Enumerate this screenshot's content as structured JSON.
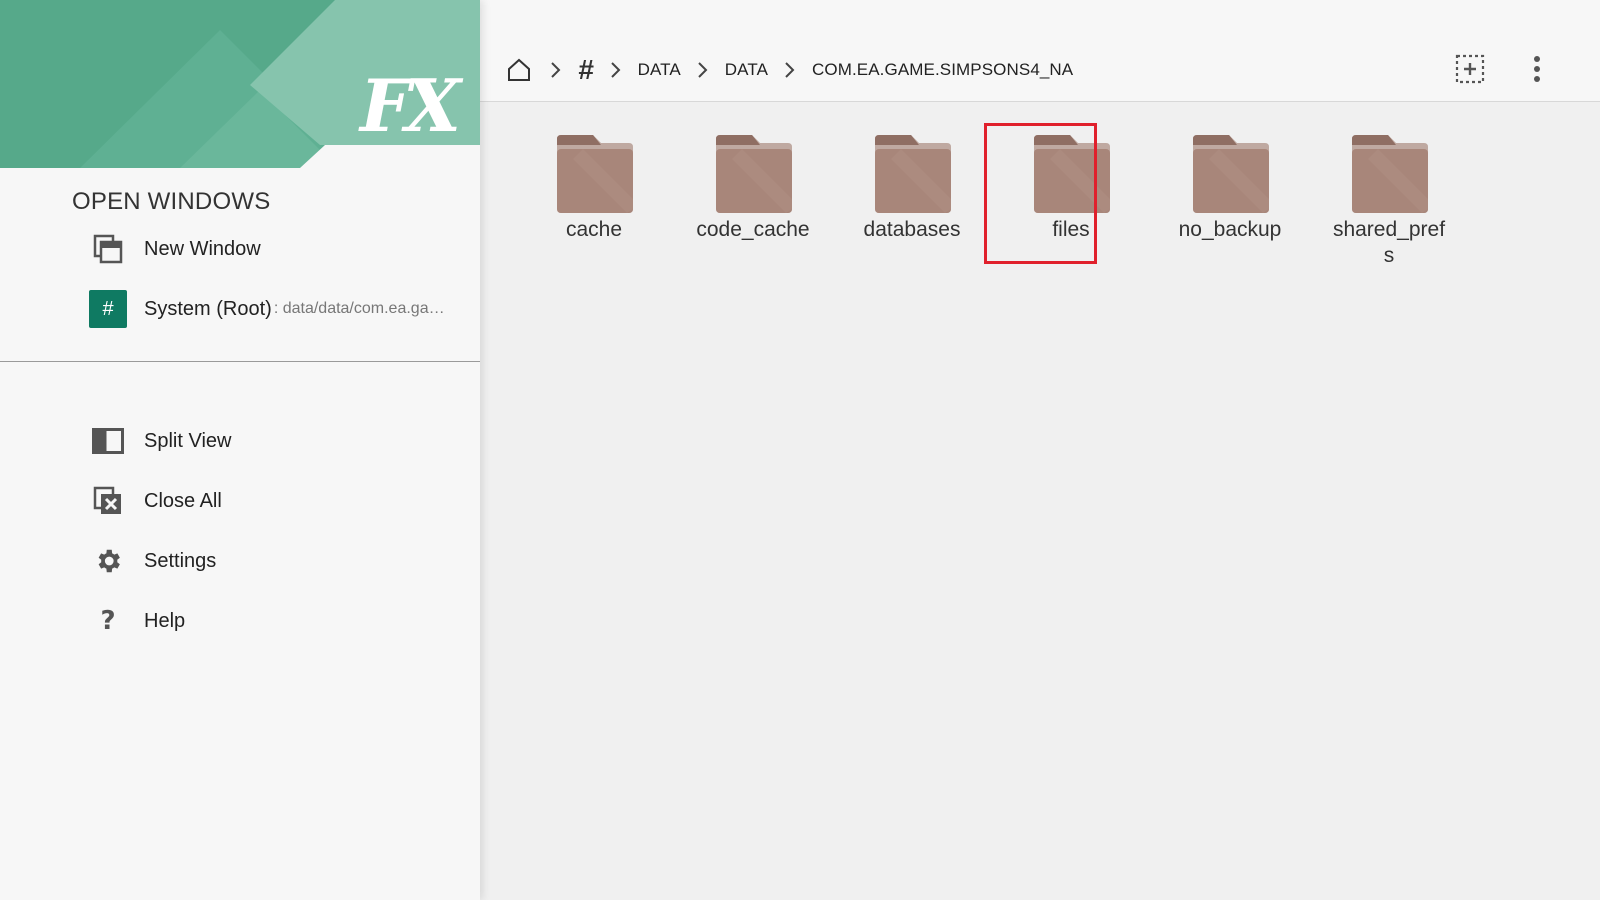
{
  "drawer": {
    "heading": "OPEN WINDOWS",
    "windows": [
      {
        "label": "New Window",
        "icon": "new-window-icon"
      },
      {
        "label": "System (Root)",
        "path": ": data/data/com.ea.game....",
        "icon": "hash-icon",
        "badge": "#"
      }
    ],
    "actions": [
      {
        "label": "Split View",
        "icon": "split-view-icon"
      },
      {
        "label": "Close All",
        "icon": "close-all-icon"
      },
      {
        "label": "Settings",
        "icon": "gear-icon"
      },
      {
        "label": "Help",
        "icon": "help-icon"
      }
    ],
    "logo_text": "FX",
    "banner_colors": [
      "#56a98a",
      "#86c4ad",
      "#6db69b"
    ]
  },
  "breadcrumb": {
    "root_symbol": "#",
    "items": [
      "DATA",
      "DATA",
      "COM.EA.GAME.SIMPSONS4_NA"
    ]
  },
  "folders": [
    "cache",
    "code_cache",
    "databases",
    "files",
    "no_backup",
    "shared_pref s"
  ],
  "selected_folder": "files",
  "colors": {
    "folder": "#a8867a",
    "folder_tab": "#8f6e63",
    "selection": "#e0202c",
    "root_badge": "#0f7a62"
  }
}
